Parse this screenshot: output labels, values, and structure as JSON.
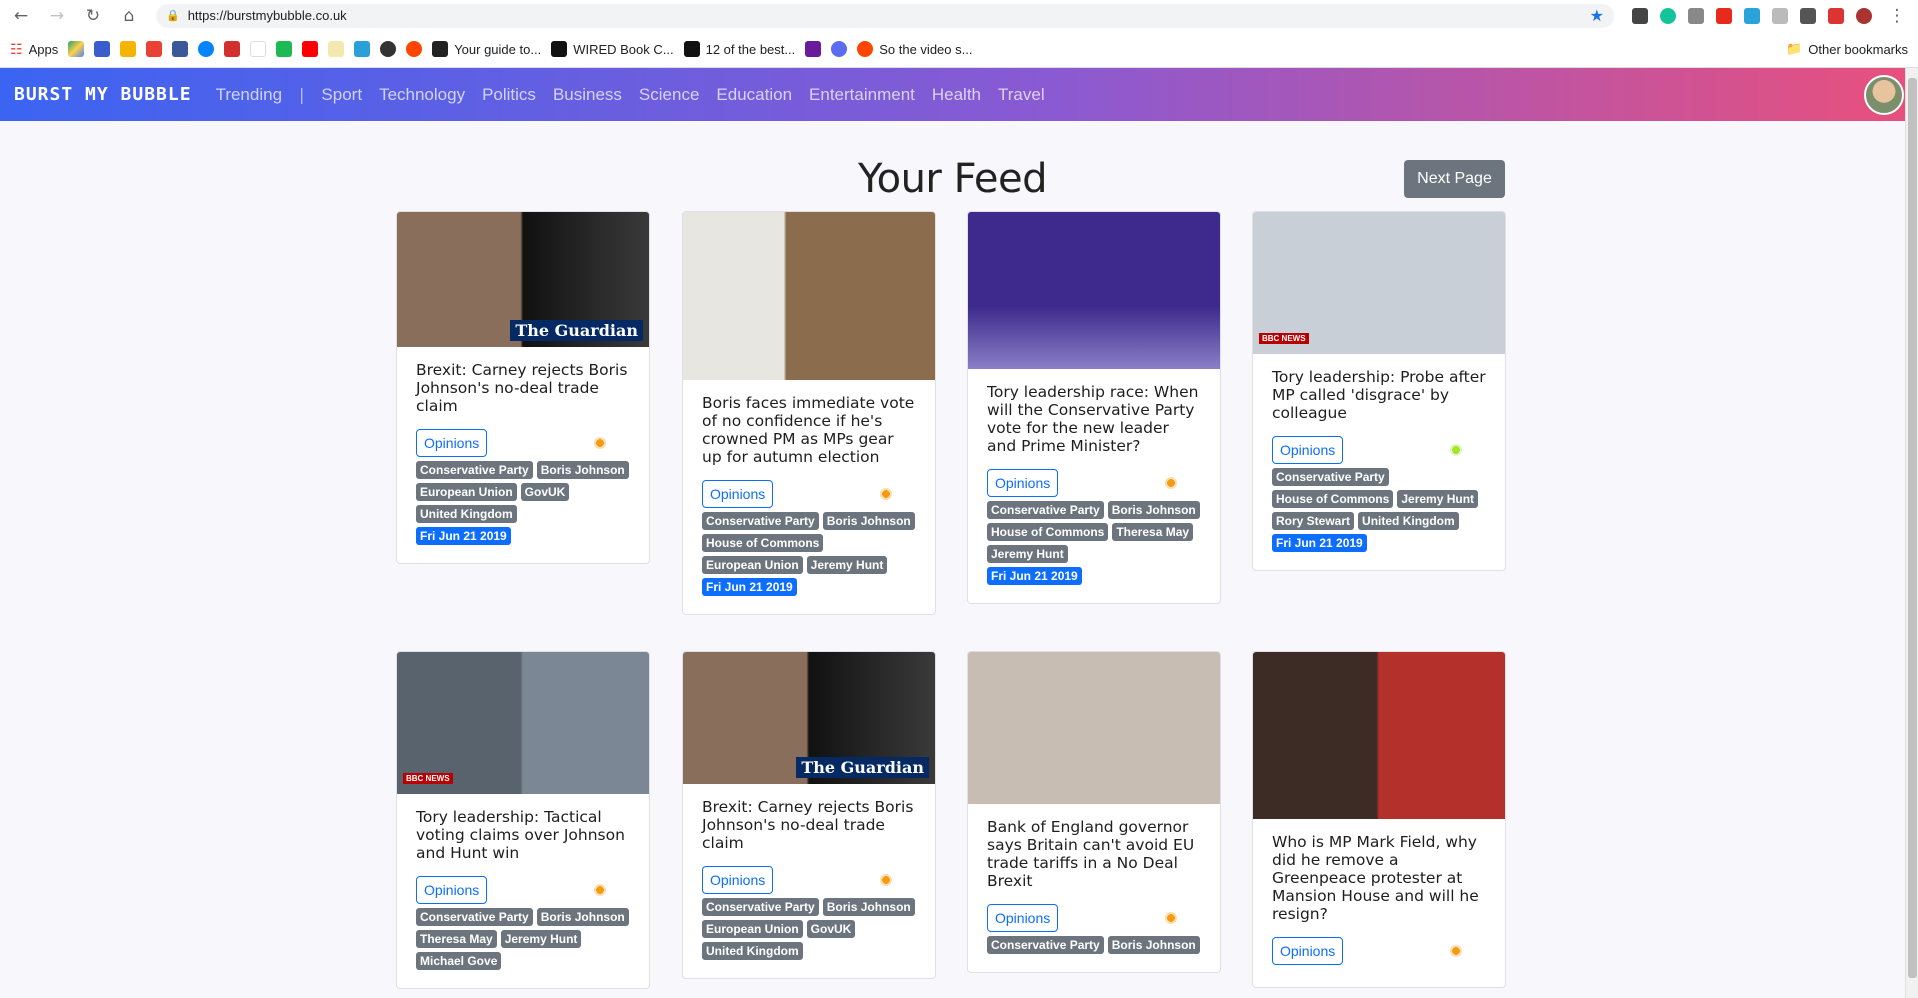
{
  "browser": {
    "url": "https://burstmybubble.co.uk",
    "bookmarks": [
      "Apps",
      "Your guide to...",
      "WIRED Book C...",
      "12 of the best...",
      "So the video s..."
    ],
    "other_bookmarks": "Other bookmarks"
  },
  "brand": "BURST MY BUBBLE",
  "nav": [
    "Trending",
    "|",
    "Sport",
    "Technology",
    "Politics",
    "Business",
    "Science",
    "Education",
    "Entertainment",
    "Health",
    "Travel"
  ],
  "page_title": "Your Feed",
  "next_label": "Next Page",
  "colors": {
    "dot_orange": "#f39c12",
    "dot_green": "#a6e22e",
    "tag": "#6c757d",
    "date": "#0d6efd"
  },
  "articles": [
    {
      "title": "Brexit: Carney rejects Boris Johnson's no-deal trade claim",
      "opinions": "Opinions",
      "dot": "orange",
      "image_logo": "The Guardian",
      "tags": [
        "Conservative Party",
        "Boris Johnson",
        "European Union",
        "GovUK",
        "United Kingdom"
      ],
      "date": "Fri Jun 21 2019"
    },
    {
      "title": "Boris faces immediate vote of no confidence if he's crowned PM as MPs gear up for autumn election",
      "opinions": "Opinions",
      "dot": "orange",
      "image_logo": "",
      "tags": [
        "Conservative Party",
        "Boris Johnson",
        "House of Commons",
        "European Union",
        "Jeremy Hunt"
      ],
      "date": "Fri Jun 21 2019"
    },
    {
      "title": "Tory leadership race: When will the Conservative Party vote for the new leader and Prime Minister?",
      "opinions": "Opinions",
      "dot": "orange",
      "image_logo": "",
      "tags": [
        "Conservative Party",
        "Boris Johnson",
        "House of Commons",
        "Theresa May",
        "Jeremy Hunt"
      ],
      "date": "Fri Jun 21 2019"
    },
    {
      "title": "Tory leadership: Probe after MP called 'disgrace' by colleague",
      "opinions": "Opinions",
      "dot": "green",
      "image_logo": "BBC NEWS",
      "tags": [
        "Conservative Party",
        "House of Commons",
        "Jeremy Hunt",
        "Rory Stewart",
        "United Kingdom"
      ],
      "date": "Fri Jun 21 2019"
    },
    {
      "title": "Tory leadership: Tactical voting claims over Johnson and Hunt win",
      "opinions": "Opinions",
      "dot": "orange",
      "image_logo": "BBC NEWS",
      "tags": [
        "Conservative Party",
        "Boris Johnson",
        "Theresa May",
        "Jeremy Hunt",
        "Michael Gove"
      ],
      "date": ""
    },
    {
      "title": "Brexit: Carney rejects Boris Johnson's no-deal trade claim",
      "opinions": "Opinions",
      "dot": "orange",
      "image_logo": "The Guardian",
      "tags": [
        "Conservative Party",
        "Boris Johnson",
        "European Union",
        "GovUK",
        "United Kingdom"
      ],
      "date": ""
    },
    {
      "title": "Bank of England governor says Britain can't avoid EU trade tariffs in a No Deal Brexit",
      "opinions": "Opinions",
      "dot": "orange",
      "image_logo": "",
      "tags": [
        "Conservative Party",
        "Boris Johnson"
      ],
      "date": ""
    },
    {
      "title": "Who is MP Mark Field, why did he remove a Greenpeace protester at Mansion House and will he resign?",
      "opinions": "Opinions",
      "dot": "orange",
      "image_logo": "",
      "tags": [],
      "date": ""
    }
  ]
}
